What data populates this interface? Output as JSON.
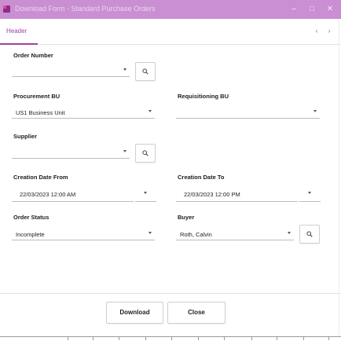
{
  "window": {
    "title": "Download Form - Standard Purchase Orders",
    "minimize_icon": "minimize-icon",
    "maximize_icon": "maximize-icon",
    "close_icon": "close-icon"
  },
  "tabs": {
    "active": "Header",
    "prev_icon": "chevron-left-icon",
    "next_icon": "chevron-right-icon"
  },
  "form": {
    "order_number": {
      "label": "Order Number",
      "value": ""
    },
    "procurement_bu": {
      "label": "Procurement BU",
      "value": "US1 Business Unit"
    },
    "requisitioning_bu": {
      "label": "Requisitioning BU",
      "value": ""
    },
    "supplier": {
      "label": "Supplier",
      "value": ""
    },
    "creation_date_from": {
      "label": "Creation Date From",
      "value": "22/03/2023 12:00 AM"
    },
    "creation_date_to": {
      "label": "Creation Date To",
      "value": "22/03/2023 12:00 PM"
    },
    "order_status": {
      "label": "Order Status",
      "value": "Incomplete"
    },
    "buyer": {
      "label": "Buyer",
      "value": "Roth, Calvin"
    }
  },
  "footer": {
    "download_label": "Download",
    "close_label": "Close"
  },
  "colors": {
    "accent": "#a43ea9",
    "titlebar": "#c98fd2"
  }
}
